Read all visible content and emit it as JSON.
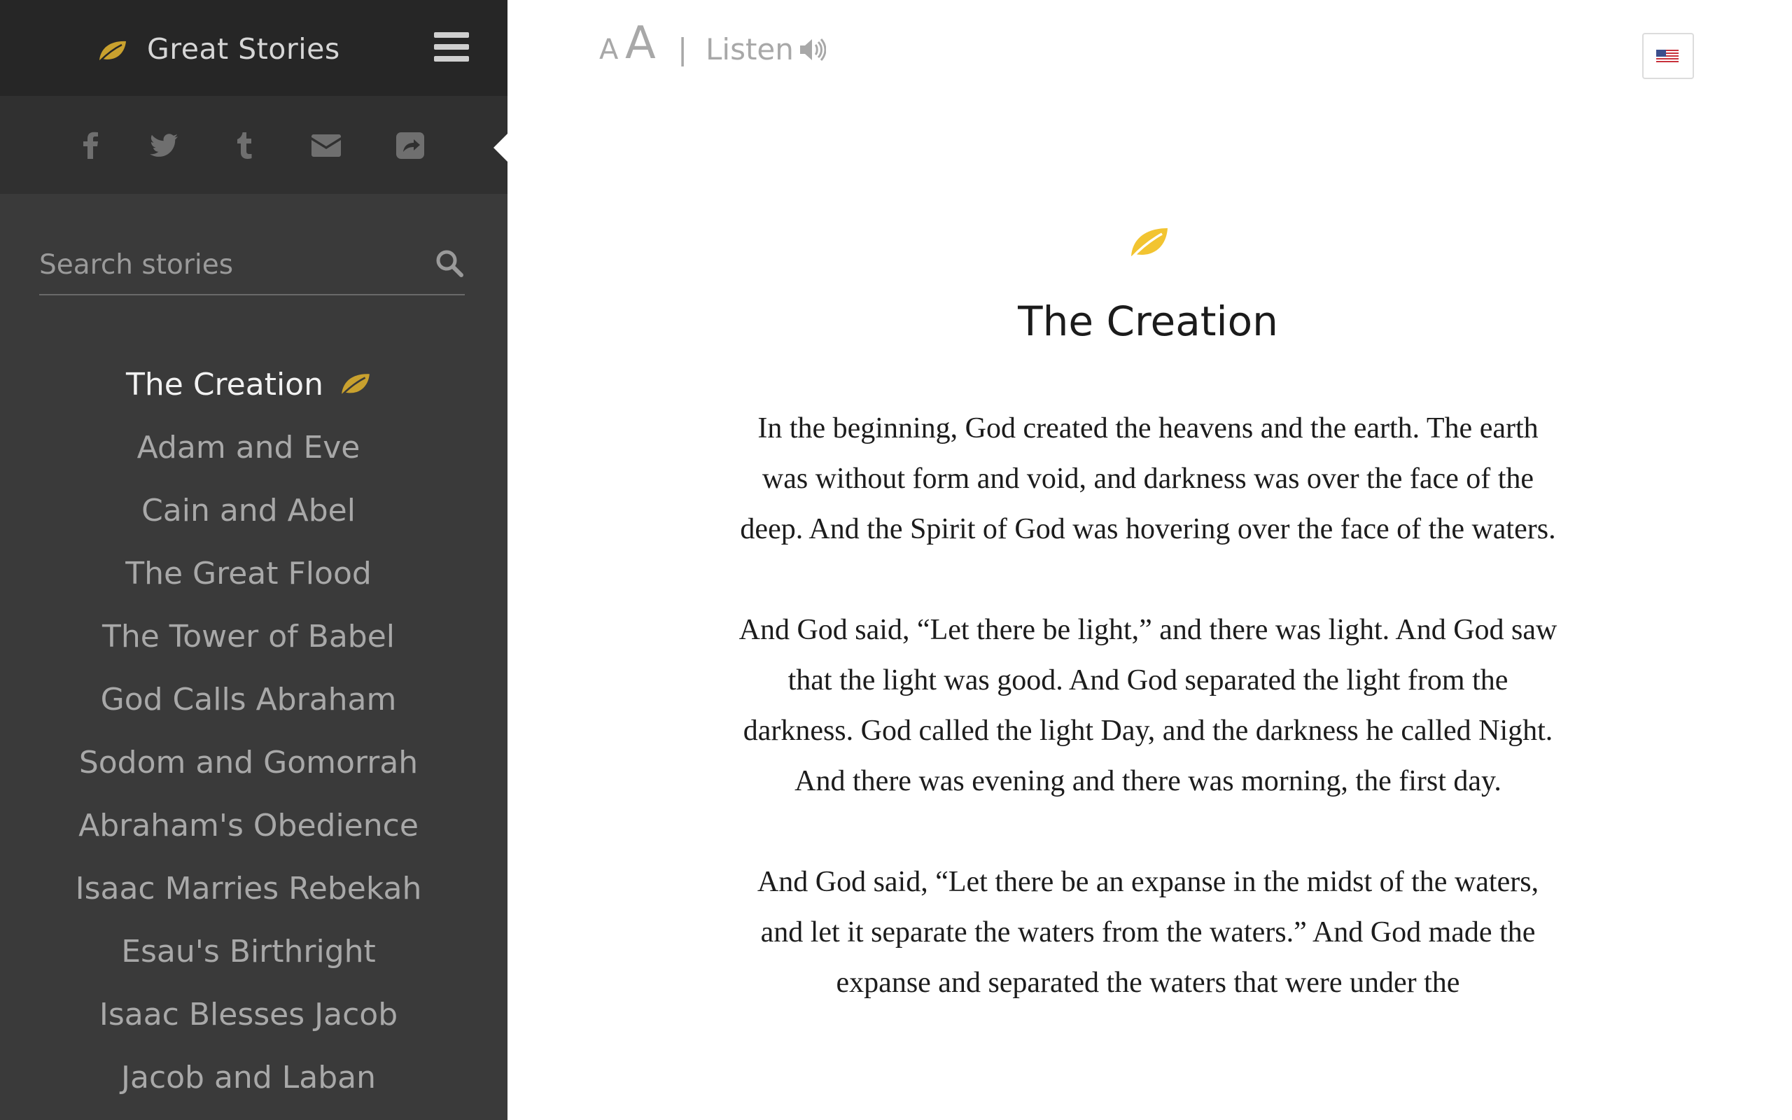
{
  "app": {
    "brand_title": "Great Stories",
    "accent_color": "#e6bb3c",
    "sidebar_color": "#3a3a3a"
  },
  "sidebar": {
    "share_icons": [
      "facebook-icon",
      "twitter-icon",
      "tumblr-icon",
      "email-icon",
      "share-icon"
    ],
    "search": {
      "placeholder": "Search stories",
      "value": ""
    },
    "stories": [
      {
        "label": "The Creation",
        "active": true
      },
      {
        "label": "Adam and Eve",
        "active": false
      },
      {
        "label": "Cain and Abel",
        "active": false
      },
      {
        "label": "The Great Flood",
        "active": false
      },
      {
        "label": "The Tower of Babel",
        "active": false
      },
      {
        "label": "God Calls Abraham",
        "active": false
      },
      {
        "label": "Sodom and Gomorrah",
        "active": false
      },
      {
        "label": "Abraham's Obedience",
        "active": false
      },
      {
        "label": "Isaac Marries Rebekah",
        "active": false
      },
      {
        "label": "Esau's Birthright",
        "active": false
      },
      {
        "label": "Isaac Blesses Jacob",
        "active": false
      },
      {
        "label": "Jacob and Laban",
        "active": false
      }
    ]
  },
  "toolbar": {
    "font_small_label": "A",
    "font_large_label": "A",
    "divider": "|",
    "listen_label": "Listen",
    "language_flag": "us-flag-icon"
  },
  "article": {
    "title": "The Creation",
    "paragraphs": [
      "In the beginning, God created the heavens and the earth. The earth was without form and void, and darkness was over the face of the deep. And the Spirit of God was hovering over the face of the waters.",
      "And God said, “Let there be light,” and there was light. And God saw that the light was good. And God separated the light from the darkness. God called the light Day, and the darkness he called Night. And there was evening and there was morning, the first day.",
      "And God said, “Let there be an expanse in the midst of the waters, and let it separate the waters from the waters.” And God made the expanse and separated the waters that were under the"
    ]
  }
}
